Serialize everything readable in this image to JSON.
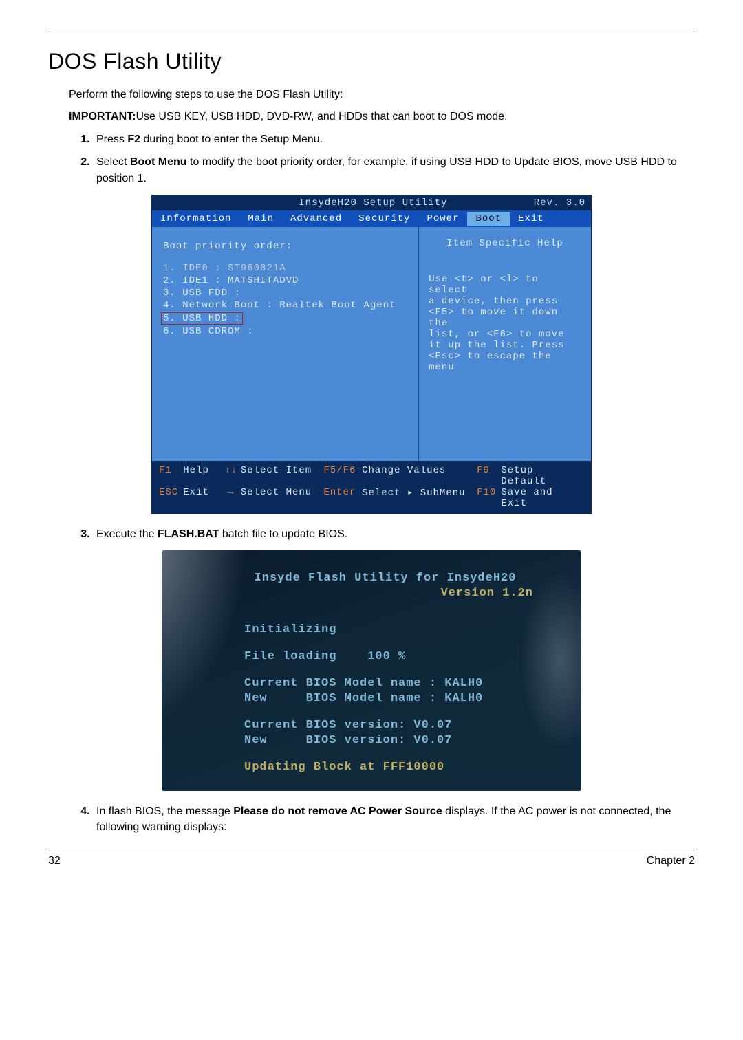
{
  "page": {
    "title": "DOS Flash Utility",
    "intro": "Perform the following steps to use the DOS Flash Utility:",
    "important_label": "IMPORTANT:",
    "important_text": "Use USB KEY, USB HDD, DVD-RW, and HDDs that can boot to DOS mode.",
    "step1_a": "Press ",
    "step1_b": "F2",
    "step1_c": " during boot to enter the Setup Menu.",
    "step2_a": "Select ",
    "step2_b": "Boot Menu",
    "step2_c": " to modify the boot priority order, for example, if using USB HDD to Update BIOS, move USB HDD to position 1.",
    "step3_a": "Execute the ",
    "step3_b": "FLASH.BAT",
    "step3_c": " batch file to update BIOS.",
    "step4_a": "In flash BIOS, the message ",
    "step4_b": "Please do not remove AC Power Source",
    "step4_c": " displays. If the AC power is not connected, the following warning displays:",
    "footer_left": "32",
    "footer_right": "Chapter 2"
  },
  "bios": {
    "title": "InsydeH20 Setup Utility",
    "rev": "Rev. 3.0",
    "tabs": [
      "Information",
      "Main",
      "Advanced",
      "Security",
      "Power",
      "Boot",
      "Exit"
    ],
    "active_tab": "Boot",
    "section_label": "Boot priority order:",
    "items": [
      "1. IDE0 : ST960821A",
      "2. IDE1 : MATSHITADVD",
      "3. USB FDD :",
      "4. Network Boot : Realtek Boot Agent",
      "5. USB HDD :",
      "6. USB CDROM :"
    ],
    "help_title": "Item Specific Help",
    "help_lines": [
      "Use <t> or <l> to select",
      "a device, then press",
      "<F5> to move it down the",
      "list, or <F6> to move",
      "it up the list. Press",
      "<Esc> to escape the menu"
    ],
    "footer": {
      "r1": {
        "k1": "F1",
        "a1": "Help",
        "arr1": "↑↓",
        "a2": "Select Item",
        "k2": "F5/F6",
        "a3": "Change Values",
        "k3": "F9",
        "a4": "Setup Default"
      },
      "r2": {
        "k1": "ESC",
        "a1": "Exit",
        "arr1": "→",
        "a2": "Select Menu",
        "k2": "Enter",
        "a3": "Select ▸ SubMenu",
        "k3": "F10",
        "a4": "Save and Exit"
      }
    }
  },
  "dos": {
    "title1": "Insyde Flash Utility for InsydeH20",
    "title2": "Version 1.2n",
    "l1": "Initializing",
    "l2": "File loading    100 %",
    "l3": "Current BIOS Model name : KALH0",
    "l4": "New     BIOS Model name : KALH0",
    "l5": "Current BIOS version: V0.07",
    "l6": "New     BIOS version: V0.07",
    "l7": "Updating Block at FFF10000"
  }
}
